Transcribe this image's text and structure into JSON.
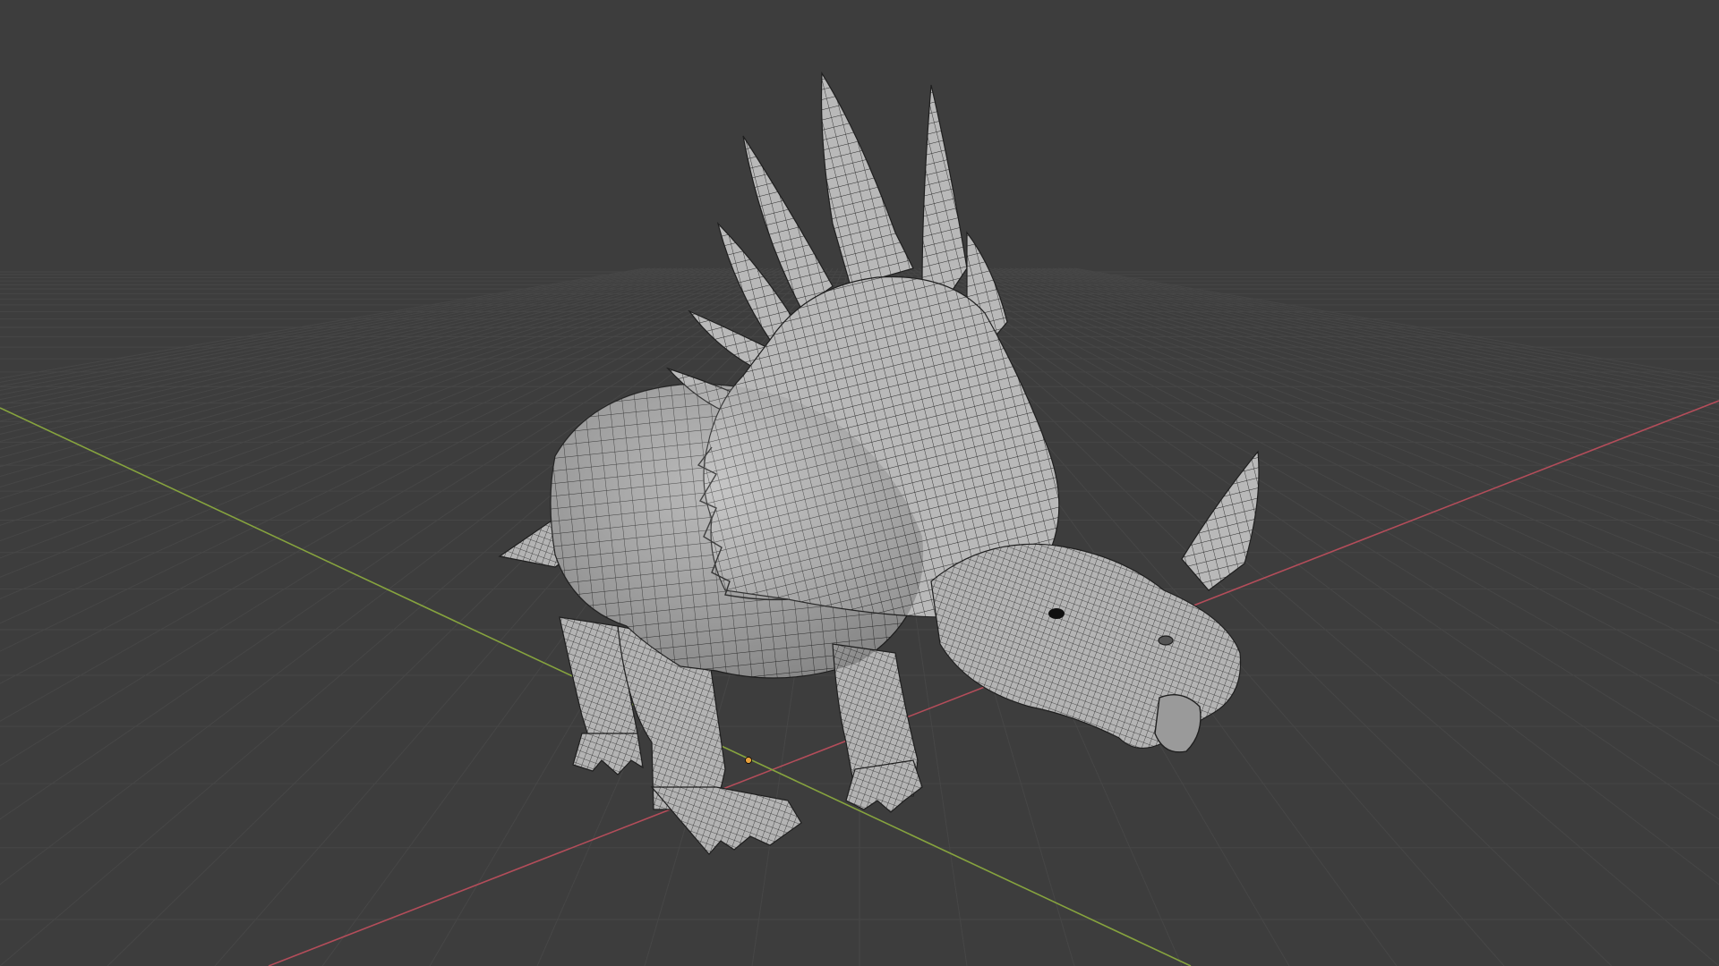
{
  "viewport": {
    "view": "3d-viewport",
    "shading": "solid-wireframe",
    "background_color": "#3d3d3d",
    "grid_color": "#4a4a4a",
    "axis_x_color": "#b34d5a",
    "axis_y_color": "#7a9a3a",
    "model_color": "#b8b8b8",
    "wire_color": "#2a2a2a"
  },
  "model": {
    "name": "",
    "type": "mesh"
  }
}
